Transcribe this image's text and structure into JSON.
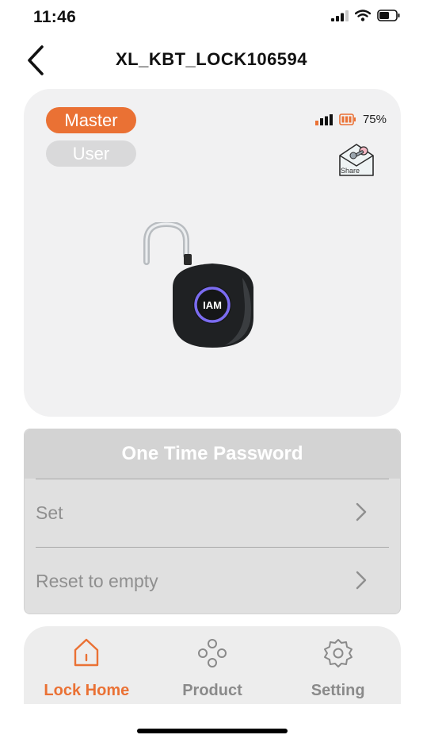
{
  "status_bar": {
    "time": "11:46",
    "battery_fill": 0.6
  },
  "header": {
    "title": "XL_KBT_LOCK106594"
  },
  "lock_card": {
    "roles": {
      "master": "Master",
      "user": "User",
      "selected": "Master"
    },
    "battery_percent": "75%",
    "share_label": "Share",
    "lock_badge": "IAM",
    "colors": {
      "accent": "#ea7134",
      "signal": "#ea7134",
      "ring": "#7b6cf0"
    }
  },
  "otp_panel": {
    "title": "One Time Password",
    "rows": [
      {
        "label": "Set"
      },
      {
        "label": "Reset to empty"
      }
    ]
  },
  "tab_bar": {
    "tabs": [
      {
        "label": "Lock Home",
        "icon": "home-icon",
        "active": true
      },
      {
        "label": "Product",
        "icon": "product-icon",
        "active": false
      },
      {
        "label": "Setting",
        "icon": "gear-icon",
        "active": false
      }
    ]
  }
}
